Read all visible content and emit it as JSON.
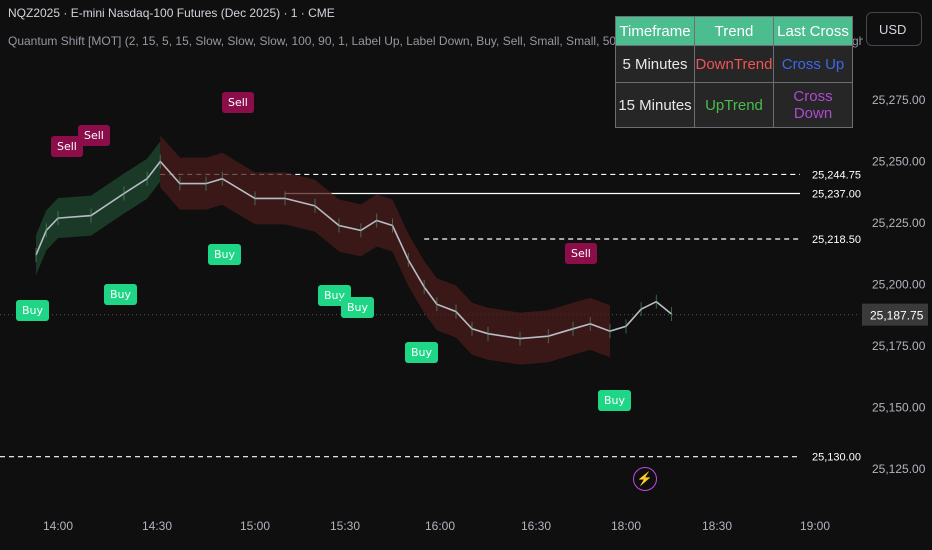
{
  "header": {
    "title": "NQZ2025 · E-mini Nasdaq-100 Futures (Dec 2025) · 1 · CME",
    "indicator": "Quantum Shift [MOT] (2, 15, 5, 15, Slow, Slow, Slow, 100, 90, 1, Label Up, Label Down, Buy, Sell, Small, Small, 50, Once per Bar Close, 1.5, 3, 1, 1, 40, Top Righ"
  },
  "currency": "USD",
  "table": {
    "headers": [
      "Timeframe",
      "Trend",
      "Last Cross"
    ],
    "rows": [
      {
        "timeframe": "5 Minutes",
        "trend": "DownTrend",
        "cross": "Cross Up"
      },
      {
        "timeframe": "15 Minutes",
        "trend": "UpTrend",
        "cross": "Cross Down"
      }
    ],
    "colors": {
      "header_bg": "#4bbd8f",
      "downtrend": "#f05454",
      "uptrend": "#4bbd4b",
      "cross_up": "#3c68e8",
      "cross_down": "#b04ad0"
    }
  },
  "chart_data": {
    "type": "line",
    "x_ticks": [
      "14:00",
      "14:30",
      "15:00",
      "15:30",
      "16:00",
      "16:30",
      "18:00",
      "18:30",
      "19:00"
    ],
    "y_ticks": [
      25125,
      25150,
      25175,
      25200,
      25225,
      25250,
      25275
    ],
    "y_tick_labels": [
      "25,125.00",
      "25,150.00",
      "25,175.00",
      "25,200.00",
      "25,225.00",
      "25,250.00",
      "25,275.00"
    ],
    "ylim": [
      25112,
      25302
    ],
    "price": [
      [
        "13:45",
        25212
      ],
      [
        "13:52",
        25222
      ],
      [
        "14:00",
        25227
      ],
      [
        "14:10",
        25228
      ],
      [
        "14:20",
        25237
      ],
      [
        "14:27",
        25243
      ],
      [
        "14:31",
        25250
      ],
      [
        "14:37",
        25241
      ],
      [
        "14:45",
        25241
      ],
      [
        "14:50",
        25243
      ],
      [
        "15:00",
        25235
      ],
      [
        "15:10",
        25235
      ],
      [
        "15:20",
        25232
      ],
      [
        "15:28",
        25224
      ],
      [
        "15:35",
        25222
      ],
      [
        "15:40",
        25226
      ],
      [
        "15:45",
        25224
      ],
      [
        "15:50",
        25210
      ],
      [
        "15:55",
        25199
      ],
      [
        "15:59",
        25192
      ],
      [
        "16:05",
        25189
      ],
      [
        "16:10",
        25182
      ],
      [
        "16:15",
        25180
      ],
      [
        "16:25",
        25178
      ],
      [
        "16:35",
        25179
      ],
      [
        "16:45",
        25182
      ],
      [
        "16:52",
        25184
      ],
      [
        "17:00",
        25181
      ],
      [
        "18:00",
        25183
      ],
      [
        "18:05",
        25190
      ],
      [
        "18:10",
        25193
      ],
      [
        "18:15",
        25188
      ]
    ],
    "levels": [
      {
        "value": 25244.75,
        "label": "25,244.75",
        "style": "dashed"
      },
      {
        "value": 25237.0,
        "label": "25,237.00",
        "style": "solid"
      },
      {
        "value": 25218.5,
        "label": "25,218.50",
        "style": "dashed"
      },
      {
        "value": 25130.0,
        "label": "25,130.00",
        "style": "dashed"
      }
    ],
    "last_price": {
      "value": 25187.75,
      "label": "25,187.75"
    },
    "signals": [
      {
        "type": "Sell",
        "time": "13:56"
      },
      {
        "type": "Sell",
        "time": "14:01"
      },
      {
        "type": "Sell",
        "time": "14:45"
      },
      {
        "type": "Sell",
        "time": "16:55"
      },
      {
        "type": "Buy",
        "time": "13:47"
      },
      {
        "type": "Buy",
        "time": "14:08"
      },
      {
        "type": "Buy",
        "time": "14:42"
      },
      {
        "type": "Buy",
        "time": "15:29"
      },
      {
        "type": "Buy",
        "time": "15:32"
      },
      {
        "type": "Buy",
        "time": "15:58"
      },
      {
        "type": "Buy",
        "time": "18:03"
      }
    ],
    "colors": {
      "price": "#b8bcc6",
      "up_cloud": "#1f4a30",
      "down_cloud": "#4a1c1c",
      "level": "#ffffff",
      "axis_text": "#b2b5be"
    }
  }
}
